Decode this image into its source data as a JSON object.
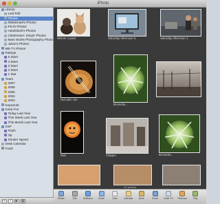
{
  "window": {
    "title": "iPhoto"
  },
  "sidebar": {
    "items": [
      {
        "label": "Library",
        "level": 0,
        "kind": "folder"
      },
      {
        "label": "Last Roll",
        "level": 1,
        "kind": "album"
      },
      {
        "label": "Photos",
        "level": 1,
        "kind": "album",
        "selected": true
      },
      {
        "label": "RDMichael's Photos",
        "level": 1,
        "kind": "album"
      },
      {
        "label": "PKJ's Photos",
        "level": 1,
        "kind": "album"
      },
      {
        "label": "Handstack's Photos",
        "level": 1,
        "kind": "album"
      },
      {
        "label": "Cledemann: Simps' Photos",
        "level": 1,
        "kind": "album"
      },
      {
        "label": "Mars Works Photography Photos",
        "level": 1,
        "kind": "album"
      },
      {
        "label": "Julian's Photos",
        "level": 1,
        "kind": "album"
      },
      {
        "label": "MB-7's Photos",
        "level": 0,
        "kind": "folder"
      },
      {
        "label": "Ratings",
        "level": 0,
        "kind": "folder"
      },
      {
        "label": "5 Stars",
        "level": 1,
        "kind": "smart"
      },
      {
        "label": "4 Stars",
        "level": 1,
        "kind": "smart"
      },
      {
        "label": "3 Stars",
        "level": 1,
        "kind": "smart"
      },
      {
        "label": "2 Stars",
        "level": 1,
        "kind": "smart"
      },
      {
        "label": "1 Star",
        "level": 1,
        "kind": "smart"
      },
      {
        "label": "Years",
        "level": 0,
        "kind": "folder"
      },
      {
        "label": "2007",
        "level": 1,
        "kind": "event"
      },
      {
        "label": "2006",
        "level": 1,
        "kind": "event"
      },
      {
        "label": "2005",
        "level": 1,
        "kind": "event"
      },
      {
        "label": "2004",
        "level": 1,
        "kind": "event"
      },
      {
        "label": "2003",
        "level": 1,
        "kind": "event"
      },
      {
        "label": "Keywords",
        "level": 0,
        "kind": "folder"
      },
      {
        "label": "Keep Fun",
        "level": 0,
        "kind": "folder"
      },
      {
        "label": "Today Last Year",
        "level": 1,
        "kind": "smart"
      },
      {
        "label": "This Week Last Year",
        "level": 1,
        "kind": "smart"
      },
      {
        "label": "This Month Last Year",
        "level": 1,
        "kind": "smart"
      },
      {
        "label": "GSF",
        "level": 0,
        "kind": "folder"
      },
      {
        "label": "Flash",
        "level": 1,
        "kind": "smart"
      },
      {
        "label": "Tilt",
        "level": 1,
        "kind": "smart"
      },
      {
        "label": "Shutter Speed",
        "level": 1,
        "kind": "smart"
      },
      {
        "label": "Desk Calendar",
        "level": 0,
        "kind": "album"
      },
      {
        "label": "Trash",
        "level": 0,
        "kind": "trash"
      }
    ]
  },
  "photos": [
    {
      "caption": "Winner x pack",
      "scene": "dogs"
    },
    {
      "caption": "Saturday Afternoon 6",
      "scene": "monitor"
    },
    {
      "caption": "Saturday Afternoon 1",
      "scene": "people"
    },
    {
      "caption": "NoCubic Joe",
      "scene": "guitar"
    },
    {
      "caption": "Bromelia...",
      "scene": "plant"
    },
    {
      "caption": "",
      "scene": "dusk"
    },
    {
      "caption": "IMG",
      "scene": "sticker"
    },
    {
      "caption": "Chipper",
      "scene": "chipper"
    },
    {
      "caption": "Bromelia...",
      "scene": "plant2"
    },
    {
      "caption": "",
      "scene": "bottom1"
    },
    {
      "caption": "",
      "scene": "bottom2"
    },
    {
      "caption": "",
      "scene": "bottom3"
    }
  ],
  "status": {
    "text": "23 photos"
  },
  "toolbar": {
    "buttons": [
      {
        "label": "Rotate",
        "icon": "rotate-icon",
        "color": "#7fa6d8"
      },
      {
        "label": "Edit",
        "icon": "edit-icon",
        "color": "#a9a9a9"
      },
      {
        "label": "Slideshow",
        "icon": "slideshow-icon",
        "color": "#6aa1e6"
      },
      {
        "label": "Email",
        "icon": "email-icon",
        "color": "#8ab1ea"
      },
      {
        "label": "Card",
        "icon": "card-icon",
        "color": "#e6e6e6"
      },
      {
        "label": "Calendar",
        "icon": "calendar-icon",
        "color": "#e6d28a"
      },
      {
        "label": "Book",
        "icon": "book-icon",
        "color": "#d9b56b"
      },
      {
        "label": "Email",
        "icon": "email2-icon",
        "color": "#7aa1cf"
      },
      {
        "label": "Order Prints",
        "icon": "prints-icon",
        "color": "#cfd9e6"
      },
      {
        "label": "Photocast",
        "icon": "photocast-icon",
        "color": "#e0a55a"
      },
      {
        "label": "Play",
        "icon": "play-icon",
        "color": "#9bb86a"
      }
    ]
  }
}
